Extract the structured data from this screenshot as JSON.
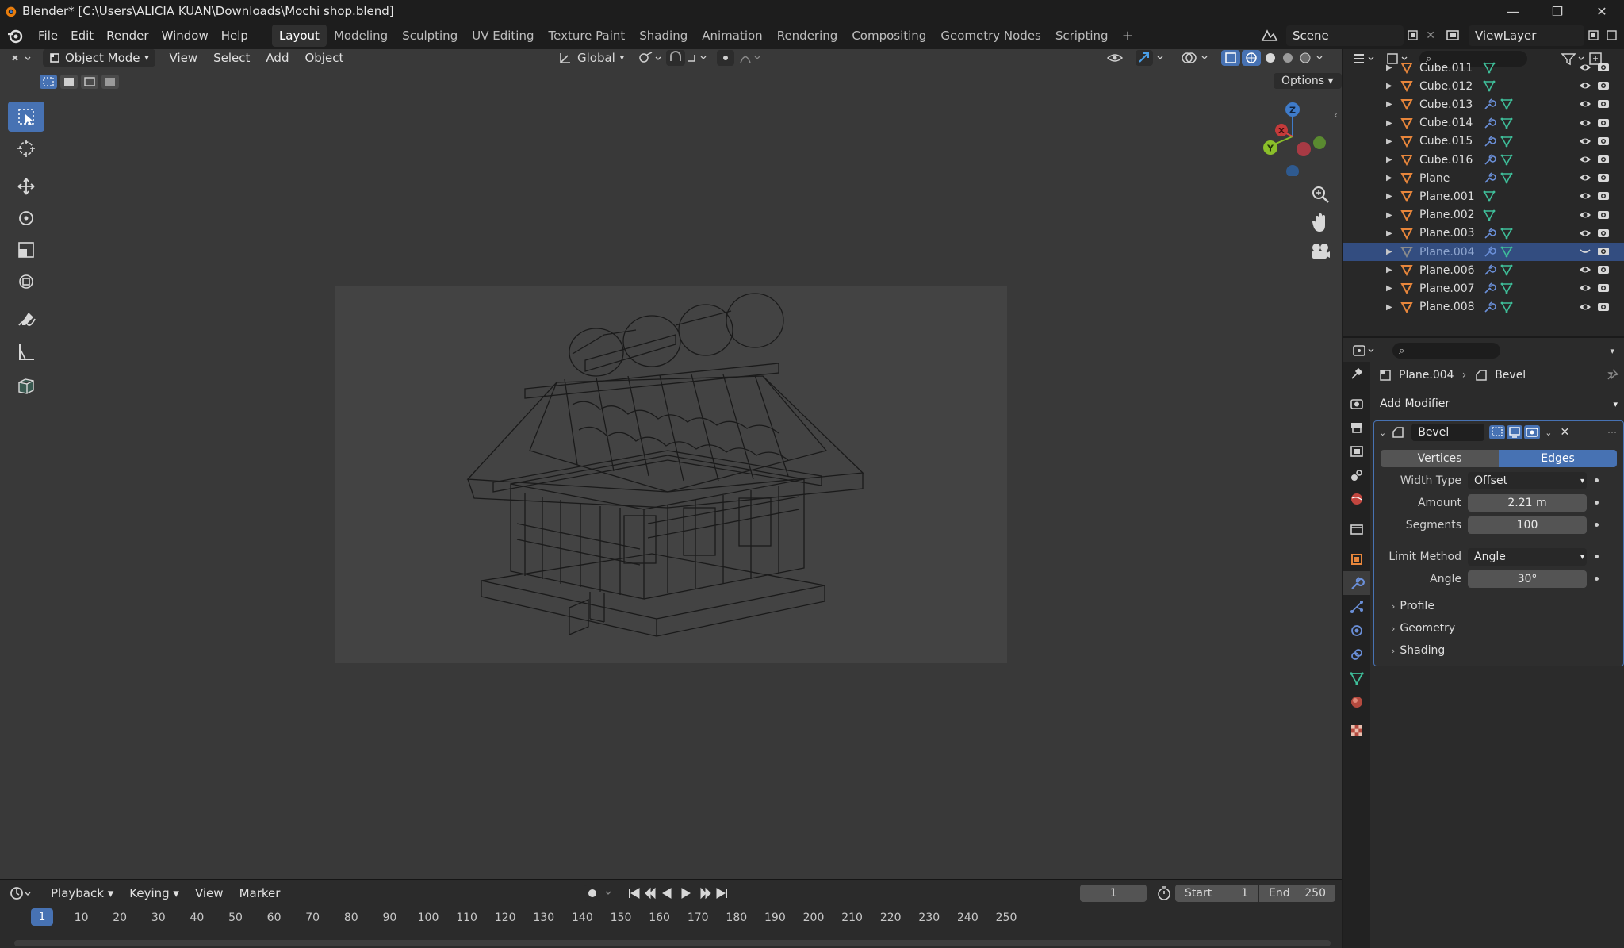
{
  "window": {
    "title": "Blender* [C:\\Users\\ALICIA KUAN\\Downloads\\Mochi shop.blend]",
    "controls": [
      "—",
      "❐",
      "✕"
    ]
  },
  "menubar": {
    "menus": [
      "File",
      "Edit",
      "Render",
      "Window",
      "Help"
    ],
    "workspaces": [
      "Layout",
      "Modeling",
      "Sculpting",
      "UV Editing",
      "Texture Paint",
      "Shading",
      "Animation",
      "Rendering",
      "Compositing",
      "Geometry Nodes",
      "Scripting"
    ],
    "active_workspace": "Layout",
    "add_workspace": "+",
    "scene": "Scene",
    "view_layer": "ViewLayer"
  },
  "viewport": {
    "mode": "Object Mode",
    "menus": [
      "View",
      "Select",
      "Add",
      "Object"
    ],
    "transform_orientation": "Global",
    "options_label": "Options",
    "gizmo_axes": [
      "Z",
      "Y",
      "X"
    ]
  },
  "timeline": {
    "menus": [
      "Playback",
      "Keying",
      "View",
      "Marker"
    ],
    "current_frame": "1",
    "start_label": "Start",
    "start": "1",
    "end_label": "End",
    "end": "250",
    "ticks": [
      "10",
      "20",
      "30",
      "40",
      "50",
      "60",
      "70",
      "80",
      "90",
      "100",
      "110",
      "120",
      "130",
      "140",
      "150",
      "160",
      "170",
      "180",
      "190",
      "200",
      "210",
      "220",
      "230",
      "240",
      "250"
    ],
    "cursor_label": "1"
  },
  "outliner": {
    "rows": [
      {
        "name": "Cube.011",
        "modifier": false
      },
      {
        "name": "Cube.012",
        "modifier": false
      },
      {
        "name": "Cube.013",
        "modifier": true
      },
      {
        "name": "Cube.014",
        "modifier": true
      },
      {
        "name": "Cube.015",
        "modifier": true
      },
      {
        "name": "Cube.016",
        "modifier": true
      },
      {
        "name": "Plane",
        "modifier": true
      },
      {
        "name": "Plane.001",
        "modifier": false
      },
      {
        "name": "Plane.002",
        "modifier": false
      },
      {
        "name": "Plane.003",
        "modifier": true
      },
      {
        "name": "Plane.004",
        "modifier": true,
        "selected": true
      },
      {
        "name": "Plane.006",
        "modifier": true
      },
      {
        "name": "Plane.007",
        "modifier": true
      },
      {
        "name": "Plane.008",
        "modifier": true
      }
    ]
  },
  "properties": {
    "object": "Plane.004",
    "modifier_crumb": "Bevel",
    "add_modifier": "Add Modifier",
    "modifier": {
      "name": "Bevel",
      "affect_vertices": "Vertices",
      "affect_edges": "Edges",
      "width_type_label": "Width Type",
      "width_type": "Offset",
      "amount_label": "Amount",
      "amount": "2.21 m",
      "segments_label": "Segments",
      "segments": "100",
      "limit_method_label": "Limit Method",
      "limit_method": "Angle",
      "angle_label": "Angle",
      "angle": "30°",
      "subpanels": [
        "Profile",
        "Geometry",
        "Shading"
      ]
    }
  },
  "colors": {
    "accent": "#4772b3",
    "object_icon": "#e8863b",
    "mesh_data": "#3fbf9a",
    "modifier_icon": "#6a8fd8"
  }
}
